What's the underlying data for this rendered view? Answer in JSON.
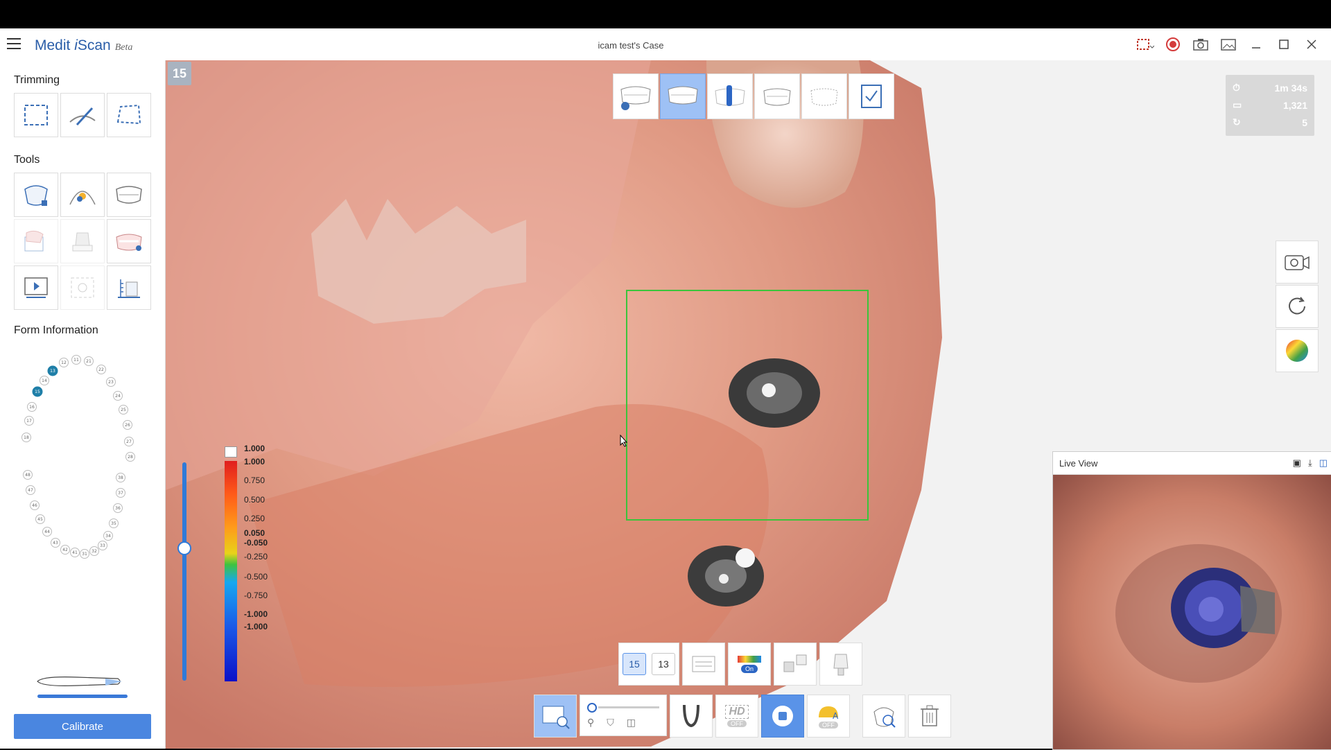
{
  "app": {
    "brand_main": "Medit ",
    "brand_i": "i",
    "brand_rest": "Scan",
    "brand_beta": "Beta",
    "doc_title": "icam test's Case"
  },
  "sidebar": {
    "trimming_title": "Trimming",
    "tools_title": "Tools",
    "form_title": "Form Information",
    "calibrate_label": "Calibrate",
    "teeth_upper": [
      "11",
      "21",
      "22",
      "23",
      "24",
      "25",
      "26",
      "27",
      "28",
      "12",
      "13",
      "14",
      "15",
      "16",
      "17",
      "18"
    ],
    "teeth_lower": [
      "31",
      "32",
      "33",
      "34",
      "35",
      "36",
      "37",
      "38",
      "41",
      "42",
      "43",
      "44",
      "45",
      "46",
      "47",
      "48"
    ],
    "teeth_selected_a": "13",
    "teeth_selected_b": "15"
  },
  "viewport": {
    "counter": "15",
    "stats": {
      "time": "1m 34s",
      "frames": "1,321",
      "count": "5"
    },
    "legend": [
      "1.000",
      "1.000",
      "0.750",
      "0.500",
      "0.250",
      "0.050",
      "-0.050",
      "-0.250",
      "-0.500",
      "-0.750",
      "-1.000",
      "-1.000"
    ],
    "tooth_chip_a": "15",
    "tooth_chip_b": "13",
    "hd_label": "HD",
    "off_label": "OFF",
    "on_label": "On"
  },
  "live_view": {
    "title": "Live View"
  },
  "colors": {
    "accent": "#4a86e0",
    "selection": "#3bc43b"
  }
}
